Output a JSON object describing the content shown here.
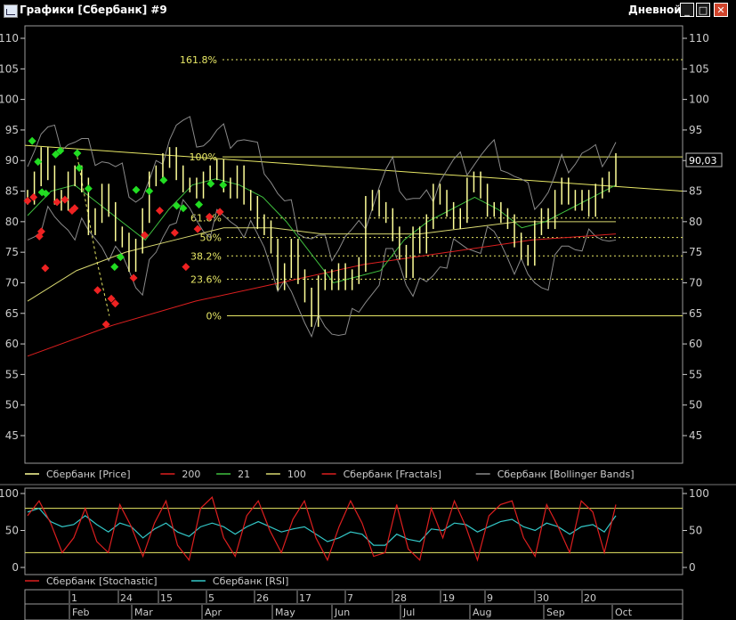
{
  "window": {
    "title": "Графики [Сбербанк] #9",
    "timeframe": "Дневной",
    "buttons": {
      "minimize": "_",
      "maximize": "□",
      "close": "✕"
    },
    "icons": {
      "app": "chart-window-icon",
      "minimize": "minimize-icon",
      "maximize": "maximize-icon",
      "close": "close-icon"
    }
  },
  "chart_data": [
    {
      "type": "line",
      "panel": "price",
      "x_categories": [
        "Feb",
        "Mar",
        "Apr",
        "May",
        "Jun",
        "Jul",
        "Aug",
        "Sep",
        "Oct"
      ],
      "day_ticks": [
        "1",
        "24",
        "15",
        "5",
        "26",
        "17",
        "7",
        "28",
        "19",
        "9",
        "30",
        "20"
      ],
      "y_ticks": [
        45,
        50,
        55,
        60,
        65,
        70,
        75,
        80,
        85,
        90,
        95,
        100,
        105,
        110
      ],
      "ylim": [
        41,
        112
      ],
      "last_price": "90,03",
      "last_price_value": 90.03,
      "series": [
        {
          "name": "Сбербанк [Price]",
          "color": "#ffff99",
          "values": [
            84,
            87,
            91,
            88,
            84,
            83,
            87,
            88,
            86,
            79,
            81,
            85,
            82,
            78,
            77,
            73,
            76,
            81,
            87,
            88,
            90,
            91,
            88,
            86,
            86,
            85,
            87,
            88,
            89,
            86,
            85,
            88,
            84,
            83,
            80,
            79,
            76,
            70,
            72,
            76,
            71,
            68,
            64,
            70,
            71,
            70,
            72,
            70,
            71,
            73,
            83,
            84,
            82,
            81,
            78,
            75,
            72,
            78,
            76,
            80,
            85,
            84,
            82,
            80,
            81,
            86,
            87,
            85,
            82,
            82,
            81,
            80,
            77,
            75,
            74,
            79,
            81,
            80,
            84,
            86,
            84,
            83,
            84,
            82,
            85,
            86,
            87,
            90
          ]
        },
        {
          "name": "200",
          "color": "#dd1f1f",
          "values": [
            58,
            63,
            67,
            70,
            73,
            75,
            77,
            78
          ]
        },
        {
          "name": "21",
          "color": "#3fbf3f",
          "values": [
            81,
            85,
            86,
            83,
            80,
            77,
            82,
            86,
            87,
            86,
            84,
            80,
            75,
            70,
            71,
            72,
            77,
            80,
            82,
            84,
            82,
            79,
            80,
            82,
            84,
            86
          ]
        },
        {
          "name": "100",
          "color": "#d8d870",
          "values": [
            67,
            72,
            75,
            77,
            79,
            79,
            78,
            78,
            78,
            79,
            80,
            80,
            80
          ]
        },
        {
          "name": "Сбербанк [Fractals]",
          "color": "#dd1f1f"
        },
        {
          "name": "Сбербанк [Bollinger Bands]",
          "color": "#8a8a8a"
        }
      ],
      "fractals_up": [
        {
          "x": 0.07,
          "y": 93.2
        },
        {
          "x": 0.16,
          "y": 89.8
        },
        {
          "x": 0.22,
          "y": 84.8
        },
        {
          "x": 0.28,
          "y": 84.6
        },
        {
          "x": 0.43,
          "y": 91.0
        },
        {
          "x": 0.5,
          "y": 91.6
        },
        {
          "x": 0.76,
          "y": 91.2
        },
        {
          "x": 0.79,
          "y": 88.8
        },
        {
          "x": 0.93,
          "y": 85.4
        },
        {
          "x": 1.33,
          "y": 72.6
        },
        {
          "x": 1.42,
          "y": 74.2
        },
        {
          "x": 1.66,
          "y": 85.2
        },
        {
          "x": 1.86,
          "y": 85.0
        },
        {
          "x": 2.08,
          "y": 86.8
        },
        {
          "x": 2.28,
          "y": 82.6
        },
        {
          "x": 2.38,
          "y": 82.2
        },
        {
          "x": 2.62,
          "y": 82.8
        },
        {
          "x": 2.8,
          "y": 86.2
        },
        {
          "x": 2.99,
          "y": 86.0
        }
      ],
      "fractals_down": [
        {
          "x": 0.0,
          "y": 83.4
        },
        {
          "x": 0.09,
          "y": 84.0
        },
        {
          "x": 0.18,
          "y": 77.6
        },
        {
          "x": 0.21,
          "y": 78.4
        },
        {
          "x": 0.27,
          "y": 72.4
        },
        {
          "x": 0.45,
          "y": 83.2
        },
        {
          "x": 0.57,
          "y": 83.6
        },
        {
          "x": 0.68,
          "y": 81.8
        },
        {
          "x": 0.72,
          "y": 82.2
        },
        {
          "x": 1.07,
          "y": 68.8
        },
        {
          "x": 1.2,
          "y": 63.2
        },
        {
          "x": 1.28,
          "y": 67.4
        },
        {
          "x": 1.34,
          "y": 66.6
        },
        {
          "x": 1.62,
          "y": 70.8
        },
        {
          "x": 1.79,
          "y": 77.8
        },
        {
          "x": 2.02,
          "y": 81.8
        },
        {
          "x": 2.25,
          "y": 78.2
        },
        {
          "x": 2.42,
          "y": 72.6
        },
        {
          "x": 2.6,
          "y": 78.8
        },
        {
          "x": 2.78,
          "y": 80.8
        },
        {
          "x": 2.94,
          "y": 81.6
        }
      ],
      "fibonacci": [
        {
          "label": "161.8%",
          "value": 106.5
        },
        {
          "label": "100%",
          "value": 90.6
        },
        {
          "label": "61.8%",
          "value": 80.6
        },
        {
          "label": "50%",
          "value": 77.4
        },
        {
          "label": "38.2%",
          "value": 74.4
        },
        {
          "label": "23.6%",
          "value": 70.6
        },
        {
          "label": "0%",
          "value": 64.6
        }
      ],
      "trendline": {
        "from": 92.5,
        "to": 85.0
      },
      "legend": [
        {
          "label": "Сбербанк [Price]",
          "color": "#ffff99"
        },
        {
          "label": "200",
          "color": "#dd1f1f"
        },
        {
          "label": "21",
          "color": "#3fbf3f"
        },
        {
          "label": "100",
          "color": "#d8d870"
        },
        {
          "label": "Сбербанк [Fractals]",
          "color": "#dd1f1f"
        },
        {
          "label": "Сбербанк [Bollinger Bands]",
          "color": "#8a8a8a"
        }
      ]
    },
    {
      "type": "line",
      "panel": "oscillator",
      "y_ticks": [
        0,
        50,
        100
      ],
      "ylim": [
        -4,
        104
      ],
      "levels": [
        20,
        80
      ],
      "series": [
        {
          "name": "Сбербанк [Stochastic]",
          "color": "#dd1f1f",
          "values": [
            70,
            90,
            60,
            20,
            40,
            80,
            35,
            20,
            85,
            55,
            15,
            60,
            90,
            30,
            10,
            80,
            95,
            40,
            15,
            70,
            90,
            50,
            20,
            65,
            90,
            40,
            10,
            55,
            90,
            60,
            15,
            20,
            85,
            25,
            10,
            80,
            40,
            90,
            55,
            10,
            70,
            85,
            90,
            40,
            15,
            85,
            55,
            20,
            90,
            75,
            20,
            85
          ]
        },
        {
          "name": "Сбербанк [RSI]",
          "color": "#33c7c7",
          "values": [
            75,
            80,
            62,
            55,
            58,
            70,
            58,
            48,
            60,
            55,
            40,
            52,
            60,
            48,
            42,
            55,
            60,
            55,
            45,
            55,
            62,
            55,
            48,
            52,
            55,
            45,
            35,
            40,
            48,
            45,
            30,
            30,
            45,
            38,
            35,
            52,
            50,
            60,
            58,
            48,
            55,
            62,
            65,
            55,
            50,
            60,
            55,
            45,
            55,
            58,
            48,
            70
          ]
        }
      ],
      "legend": [
        {
          "label": "Сбербанк [Stochastic]",
          "color": "#dd1f1f"
        },
        {
          "label": "Сбербанк [RSI]",
          "color": "#33c7c7"
        }
      ]
    }
  ]
}
